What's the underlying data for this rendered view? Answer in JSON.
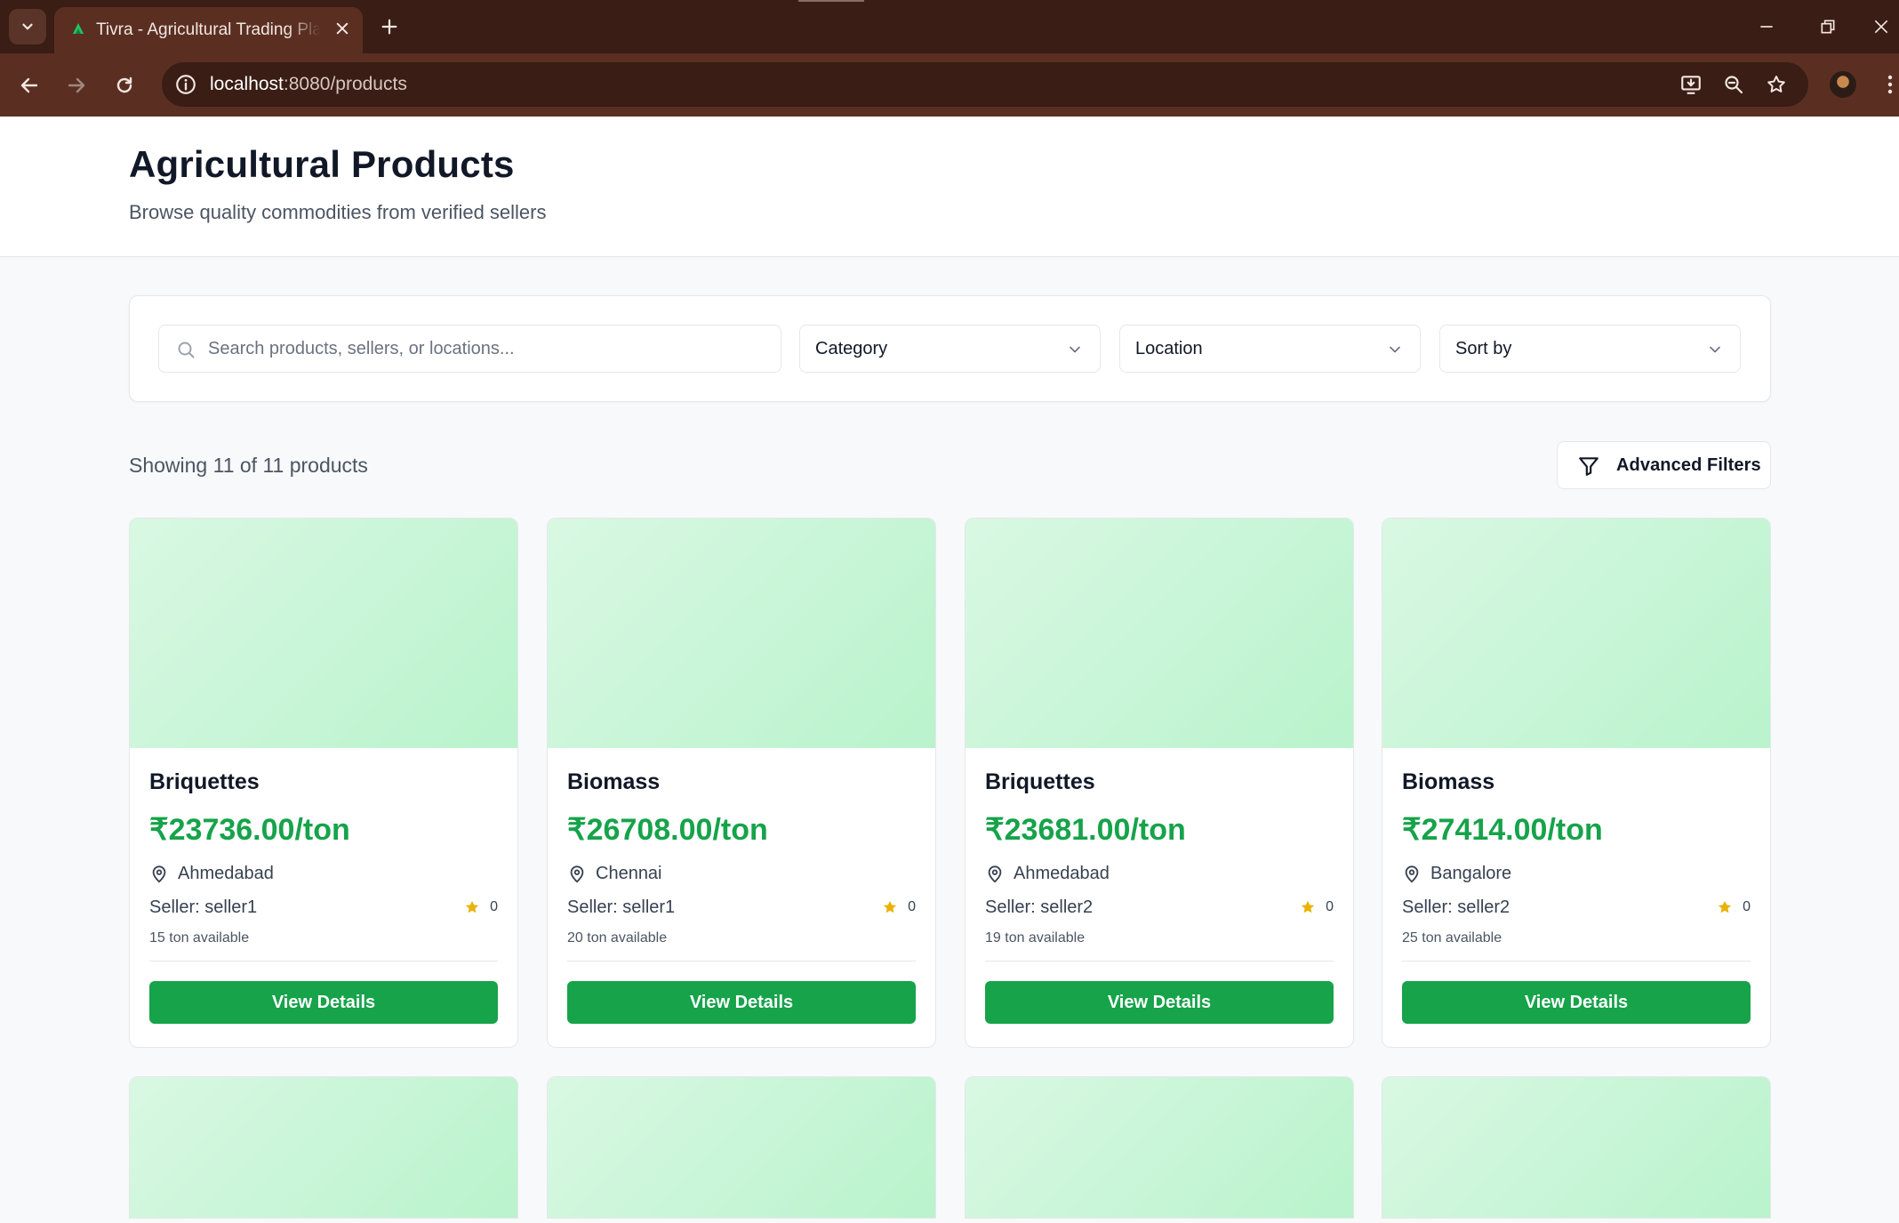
{
  "browser": {
    "tab_title": "Tivra - Agricultural Trading Platform",
    "url_host": "localhost",
    "url_rest": ":8080/products"
  },
  "header": {
    "title": "Agricultural Products",
    "subtitle": "Browse quality commodities from verified sellers"
  },
  "filters": {
    "search_placeholder": "Search products, sellers, or locations...",
    "category_label": "Category",
    "location_label": "Location",
    "sort_label": "Sort by"
  },
  "results": {
    "summary": "Showing 11 of 11 products",
    "advanced_filters_label": "Advanced Filters"
  },
  "products": [
    {
      "name": "Briquettes",
      "price": "₹23736.00/ton",
      "location": "Ahmedabad",
      "seller": "Seller: seller1",
      "rating": "0",
      "availability": "15 ton available",
      "button": "View Details"
    },
    {
      "name": "Biomass",
      "price": "₹26708.00/ton",
      "location": "Chennai",
      "seller": "Seller: seller1",
      "rating": "0",
      "availability": "20 ton available",
      "button": "View Details"
    },
    {
      "name": "Briquettes",
      "price": "₹23681.00/ton",
      "location": "Ahmedabad",
      "seller": "Seller: seller2",
      "rating": "0",
      "availability": "19 ton available",
      "button": "View Details"
    },
    {
      "name": "Biomass",
      "price": "₹27414.00/ton",
      "location": "Bangalore",
      "seller": "Seller: seller2",
      "rating": "0",
      "availability": "25 ton available",
      "button": "View Details"
    }
  ],
  "colors": {
    "accent_green": "#16a34a",
    "image_placeholder": "#c6f6d5",
    "star": "#eab308",
    "browser_frame": "#3a1d14"
  },
  "icons": [
    "search-icon",
    "chevron-down-icon",
    "filter-icon",
    "map-pin-icon",
    "star-icon"
  ]
}
